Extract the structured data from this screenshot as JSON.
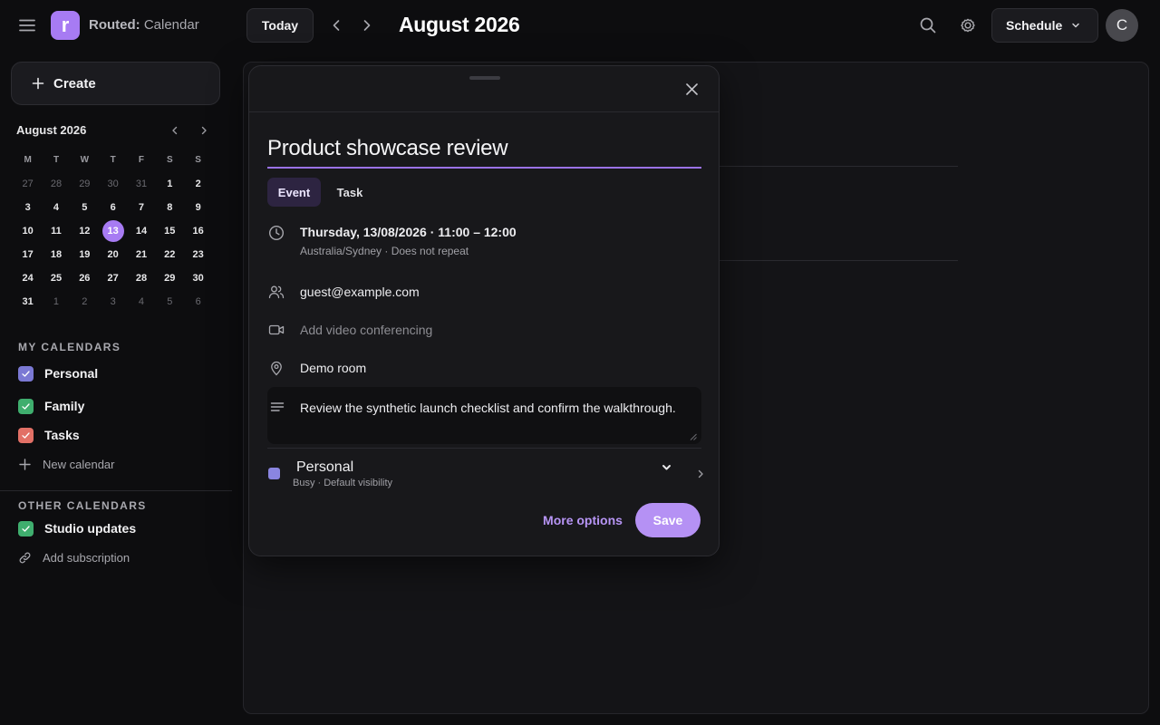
{
  "app": {
    "brand": "Routed:",
    "name": "Calendar",
    "logo_letter": "r"
  },
  "header": {
    "today_label": "Today",
    "month_title": "August 2026",
    "view_label": "Schedule",
    "avatar_initial": "C"
  },
  "sidebar": {
    "create_label": "Create",
    "mini_calendar": {
      "title": "August 2026",
      "weekdays": [
        "M",
        "T",
        "W",
        "T",
        "F",
        "S",
        "S"
      ],
      "weeks": [
        [
          {
            "d": "27",
            "m": true
          },
          {
            "d": "28",
            "m": true
          },
          {
            "d": "29",
            "m": true
          },
          {
            "d": "30",
            "m": true
          },
          {
            "d": "31",
            "m": true
          },
          {
            "d": "1"
          },
          {
            "d": "2"
          }
        ],
        [
          {
            "d": "3"
          },
          {
            "d": "4"
          },
          {
            "d": "5"
          },
          {
            "d": "6"
          },
          {
            "d": "7"
          },
          {
            "d": "8"
          },
          {
            "d": "9"
          }
        ],
        [
          {
            "d": "10"
          },
          {
            "d": "11"
          },
          {
            "d": "12"
          },
          {
            "d": "13",
            "sel": true
          },
          {
            "d": "14"
          },
          {
            "d": "15"
          },
          {
            "d": "16"
          }
        ],
        [
          {
            "d": "17"
          },
          {
            "d": "18"
          },
          {
            "d": "19"
          },
          {
            "d": "20"
          },
          {
            "d": "21"
          },
          {
            "d": "22"
          },
          {
            "d": "23"
          }
        ],
        [
          {
            "d": "24"
          },
          {
            "d": "25"
          },
          {
            "d": "26"
          },
          {
            "d": "27"
          },
          {
            "d": "28"
          },
          {
            "d": "29"
          },
          {
            "d": "30"
          }
        ],
        [
          {
            "d": "31"
          },
          {
            "d": "1",
            "m": true
          },
          {
            "d": "2",
            "m": true
          },
          {
            "d": "3",
            "m": true
          },
          {
            "d": "4",
            "m": true
          },
          {
            "d": "5",
            "m": true
          },
          {
            "d": "6",
            "m": true
          }
        ]
      ]
    },
    "my_calendars_heading": "MY CALENDARS",
    "my_calendars": [
      {
        "name": "Personal",
        "color": "#7b79d4"
      },
      {
        "name": "Family",
        "color": "#3fae6e"
      },
      {
        "name": "Tasks",
        "color": "#e27066"
      }
    ],
    "new_calendar_label": "New calendar",
    "other_calendars_heading": "OTHER CALENDARS",
    "other_calendars": [
      {
        "name": "Studio updates",
        "color": "#3fae6e"
      }
    ],
    "add_subscription_label": "Add subscription"
  },
  "event_dialog": {
    "title": "Product showcase review",
    "tabs": {
      "event": "Event",
      "task": "Task"
    },
    "datetime": "Thursday, 13/08/2026 · 11:00 – 12:00",
    "timezone_repeat": "Australia/Sydney · Does not repeat",
    "guest": "guest@example.com",
    "video_placeholder": "Add video conferencing",
    "location": "Demo room",
    "description": "Review the synthetic launch checklist and confirm the walkthrough.",
    "calendar": {
      "name": "Personal",
      "meta": "Busy · Default visibility",
      "color": "#8a85e0"
    },
    "more_options_label": "More options",
    "save_label": "Save"
  },
  "colors": {
    "accent": "#a77bf3",
    "save_button": "#b591f4",
    "title_underline": "#9a72e6"
  }
}
